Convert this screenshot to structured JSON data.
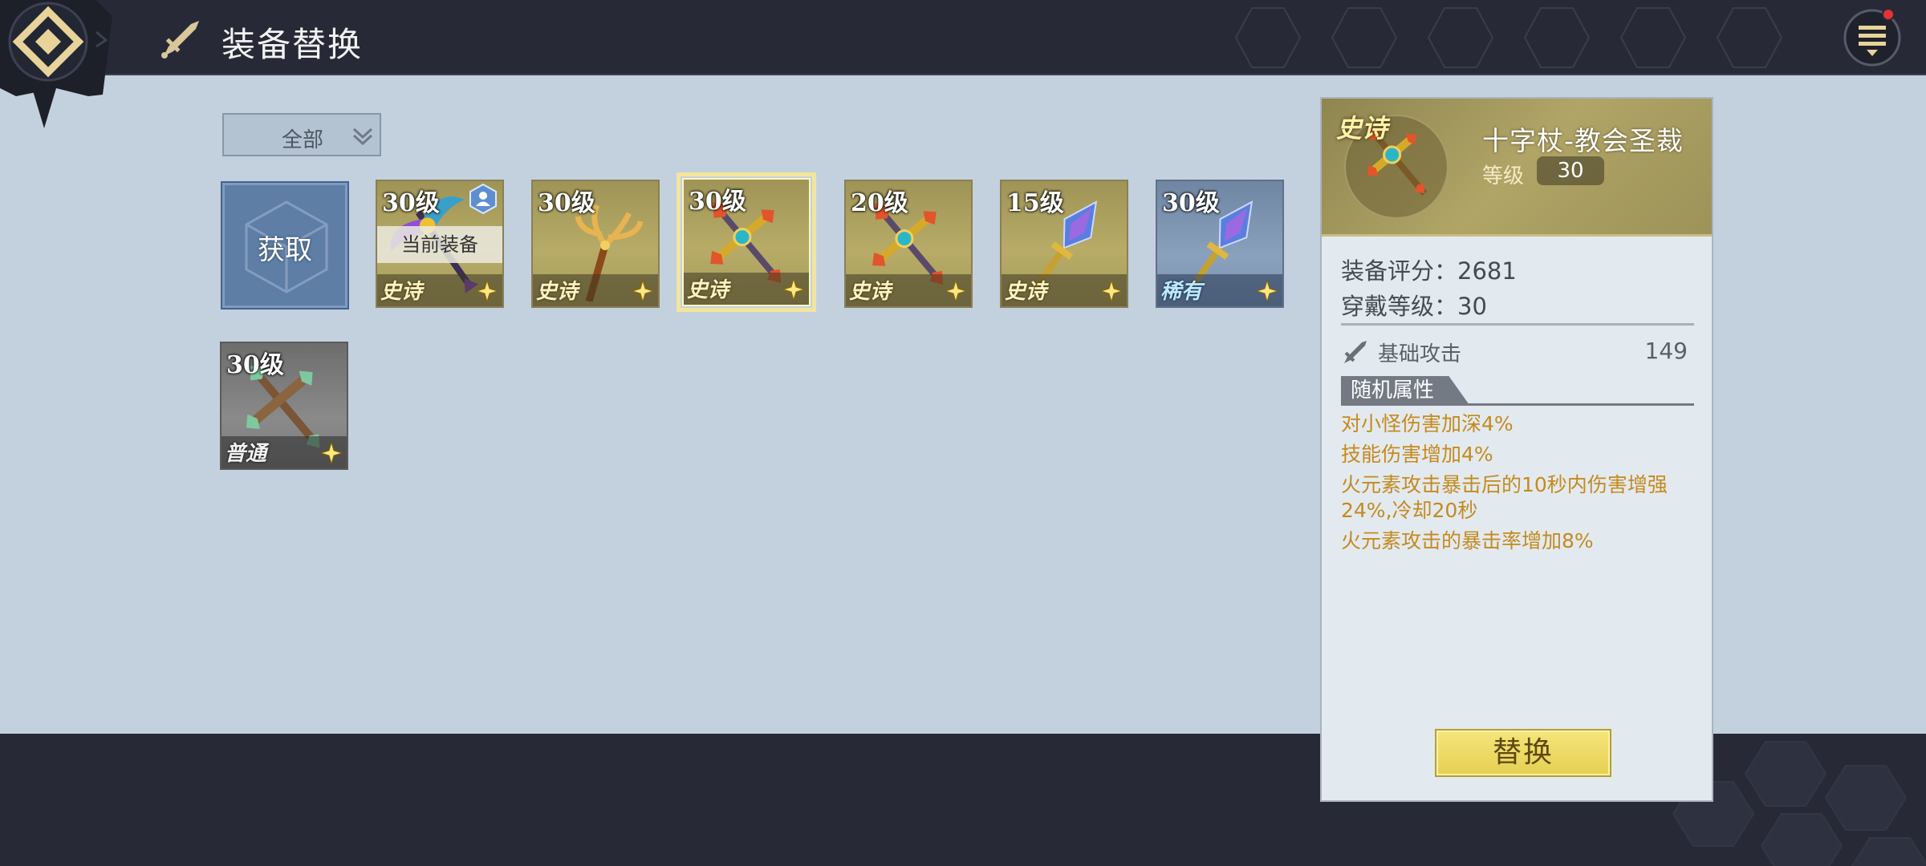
{
  "header": {
    "title": "装备替换",
    "back_icon": "diamond-arrow-icon",
    "menu_icon": "list-menu-icon",
    "has_notification": true
  },
  "filter": {
    "selected": "全部"
  },
  "obtain_label": "获取",
  "items": [
    {
      "level": "30级",
      "rarity": "史诗",
      "kind": "epic",
      "equipped": true,
      "equipped_label": "当前装备",
      "weapon": "winged-staff"
    },
    {
      "level": "30级",
      "rarity": "史诗",
      "kind": "epic",
      "equipped": false,
      "weapon": "antler-staff"
    },
    {
      "level": "30级",
      "rarity": "史诗",
      "kind": "epic",
      "equipped": false,
      "selected": true,
      "weapon": "cross-staff"
    },
    {
      "level": "20级",
      "rarity": "史诗",
      "kind": "epic",
      "equipped": false,
      "weapon": "cross-staff"
    },
    {
      "level": "15级",
      "rarity": "史诗",
      "kind": "epic",
      "equipped": false,
      "weapon": "crystal-staff"
    },
    {
      "level": "30级",
      "rarity": "稀有",
      "kind": "rare",
      "equipped": false,
      "weapon": "crystal-staff"
    },
    {
      "level": "30级",
      "rarity": "普通",
      "kind": "common",
      "equipped": false,
      "weapon": "wood-cross-staff"
    }
  ],
  "detail": {
    "rarity": "史诗",
    "name": "十字杖-教会圣裁",
    "level_label": "等级",
    "level_value": "30",
    "score_line": "装备评分：2681",
    "req_line": "穿戴等级：30",
    "base_attack_label": "基础攻击",
    "base_attack_value": "149",
    "random_attr_label": "随机属性",
    "attributes": [
      "对小怪伤害加深4%",
      "技能伤害增加4%",
      "火元素攻击暴击后的10秒内伤害增强24%,冷却20秒",
      "火元素攻击的暴击率增加8%"
    ],
    "replace_label": "替换"
  },
  "colors": {
    "epic": "#b0a466",
    "rare": "#8aa1bd",
    "common": "#8a8a8a",
    "attr_text": "#c48a1e",
    "replace_button": "#eedb66"
  }
}
